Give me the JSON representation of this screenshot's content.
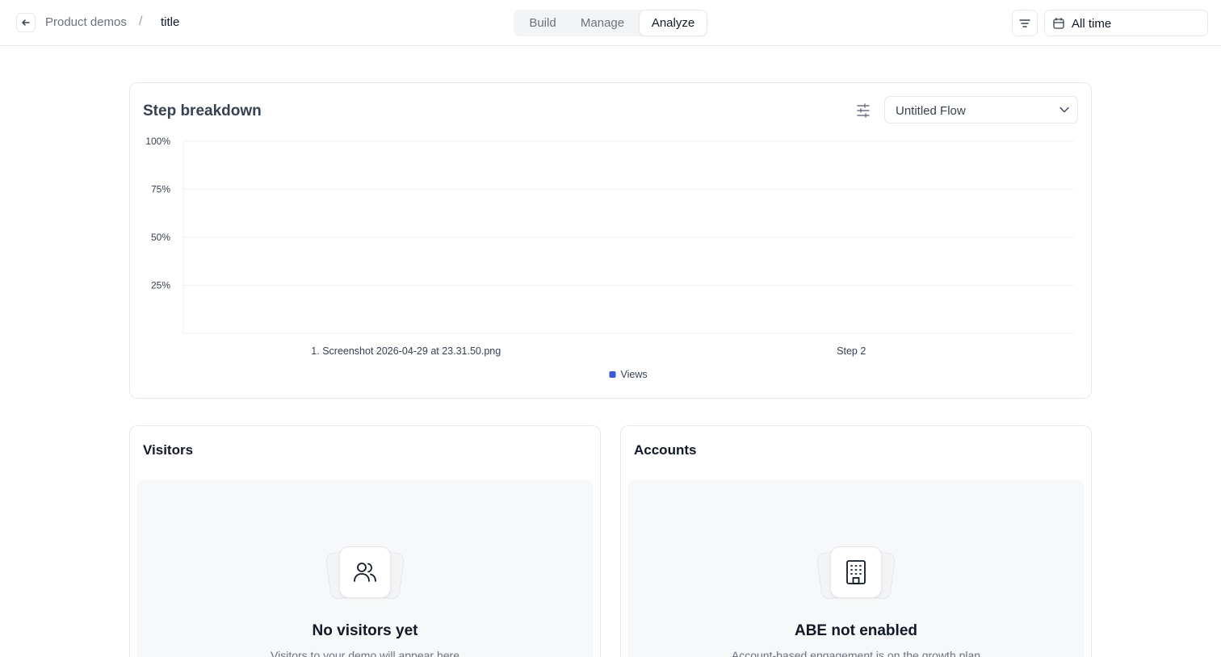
{
  "breadcrumb": {
    "parent": "Product demos",
    "separator": "/",
    "current": "title"
  },
  "tabs": [
    {
      "label": "Build"
    },
    {
      "label": "Manage"
    },
    {
      "label": "Analyze",
      "active": true
    }
  ],
  "date_filter": {
    "label": "All time"
  },
  "step_breakdown": {
    "title": "Step breakdown",
    "flow_select": {
      "value": "Untitled Flow"
    }
  },
  "chart_data": {
    "type": "bar",
    "title": "",
    "xlabel": "",
    "ylabel": "",
    "ylim": [
      0,
      100
    ],
    "yticks": [
      "100%",
      "75%",
      "50%",
      "25%"
    ],
    "categories": [
      "1. Screenshot 2026-04-29 at 23.31.50.png",
      "Step 2"
    ],
    "series": [
      {
        "name": "Views",
        "values": [
          0,
          0
        ],
        "color": "#3b5bdb"
      }
    ],
    "grid": true,
    "legend": "bottom-center"
  },
  "visitors": {
    "title": "Visitors",
    "empty_title": "No visitors yet",
    "empty_subtitle": "Visitors to your demo will appear here"
  },
  "accounts": {
    "title": "Accounts",
    "empty_title": "ABE not enabled",
    "empty_subtitle": "Account-based engagement is on the growth plan"
  },
  "colors": {
    "accent": "#3b5bdb",
    "border": "#e5e7eb",
    "muted": "#6b7280"
  }
}
